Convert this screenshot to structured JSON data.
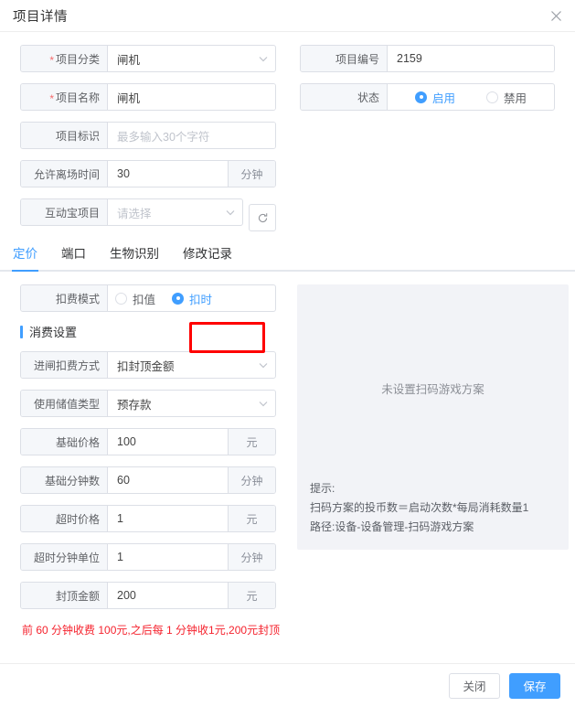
{
  "dialog": {
    "title": "项目详情",
    "close_icon": "close-icon"
  },
  "basic_form": {
    "left": [
      {
        "label": "项目分类",
        "required": true,
        "value": "闸机",
        "type": "select"
      },
      {
        "label": "项目名称",
        "required": true,
        "value": "闸机",
        "type": "text"
      },
      {
        "label": "项目标识",
        "required": false,
        "value": "",
        "placeholder": "最多输入30个字符",
        "type": "text"
      },
      {
        "label": "允许离场时间",
        "required": false,
        "value": "30",
        "suffix": "分钟",
        "type": "text"
      },
      {
        "label": "互动宝项目",
        "required": false,
        "value": "",
        "placeholder": "请选择",
        "type": "select",
        "refresh": "refresh-icon"
      }
    ],
    "right": {
      "project_no": {
        "label": "项目编号",
        "value": "2159"
      },
      "status": {
        "label": "状态",
        "options": [
          {
            "label": "启用",
            "checked": true
          },
          {
            "label": "禁用",
            "checked": false
          }
        ]
      }
    }
  },
  "tabs": [
    {
      "label": "定价",
      "active": true
    },
    {
      "label": "端口",
      "active": false
    },
    {
      "label": "生物识别",
      "active": false
    },
    {
      "label": "修改记录",
      "active": false
    }
  ],
  "pricing": {
    "charge_mode": {
      "label": "扣费模式",
      "options": [
        {
          "label": "扣值",
          "checked": false
        },
        {
          "label": "扣时",
          "checked": true
        }
      ],
      "highlight_color": "#ff0000"
    },
    "section_title": "消费设置",
    "fields": [
      {
        "label": "进闸扣费方式",
        "value": "扣封顶金额",
        "type": "select"
      },
      {
        "label": "使用储值类型",
        "value": "预存款",
        "type": "select"
      },
      {
        "label": "基础价格",
        "value": "100",
        "suffix": "元",
        "type": "text"
      },
      {
        "label": "基础分钟数",
        "value": "60",
        "suffix": "分钟",
        "type": "text"
      },
      {
        "label": "超时价格",
        "value": "1",
        "suffix": "元",
        "type": "text"
      },
      {
        "label": "超时分钟单位",
        "value": "1",
        "suffix": "分钟",
        "type": "text"
      },
      {
        "label": "封顶金额",
        "value": "200",
        "suffix": "元",
        "type": "text"
      }
    ],
    "summary": "前 60 分钟收费 100元,之后每 1 分钟收1元,200元封顶"
  },
  "info_panel": {
    "empty_text": "未设置扫码游戏方案",
    "hint_title": "提示:",
    "hint_line1": "扫码方案的投币数＝启动次数*每局消耗数量1",
    "hint_line2": "路径:设备-设备管理-扫码游戏方案"
  },
  "footer": {
    "close_label": "关闭",
    "save_label": "保存"
  },
  "colors": {
    "primary": "#409eff",
    "danger": "#f5222d",
    "annotation": "#ff0000",
    "label_bg": "#f5f7fa",
    "panel_bg": "#f2f3f7"
  }
}
